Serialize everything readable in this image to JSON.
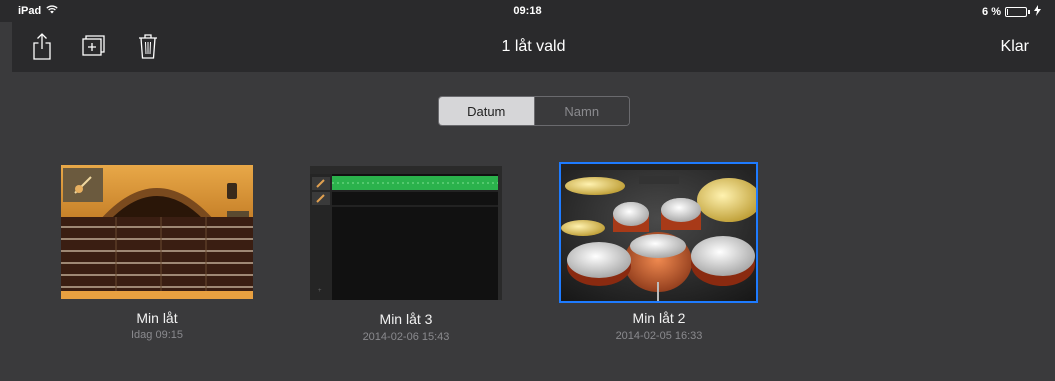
{
  "status_bar": {
    "device": "iPad",
    "time": "09:18",
    "battery_percent": "6 %",
    "battery_level": 0.06
  },
  "nav_bar": {
    "title": "1 låt vald",
    "done_label": "Klar",
    "icons": [
      "share-icon",
      "duplicate-icon",
      "trash-icon"
    ]
  },
  "sort": {
    "options": [
      "Datum",
      "Namn"
    ],
    "selected": "Datum"
  },
  "documents": [
    {
      "title": "Min låt",
      "date": "Idag 09:15",
      "instrument": "guitar",
      "selected": false
    },
    {
      "title": "Min låt 3",
      "date": "2014-02-06 15:43",
      "instrument": "tracks",
      "selected": false
    },
    {
      "title": "Min låt 2",
      "date": "2014-02-05 16:33",
      "instrument": "drums",
      "selected": true
    }
  ],
  "colors": {
    "background": "#3a3a3c",
    "bar": "#2a2a2c",
    "selection": "#1e7bff",
    "track_green": "#2bb24c"
  }
}
